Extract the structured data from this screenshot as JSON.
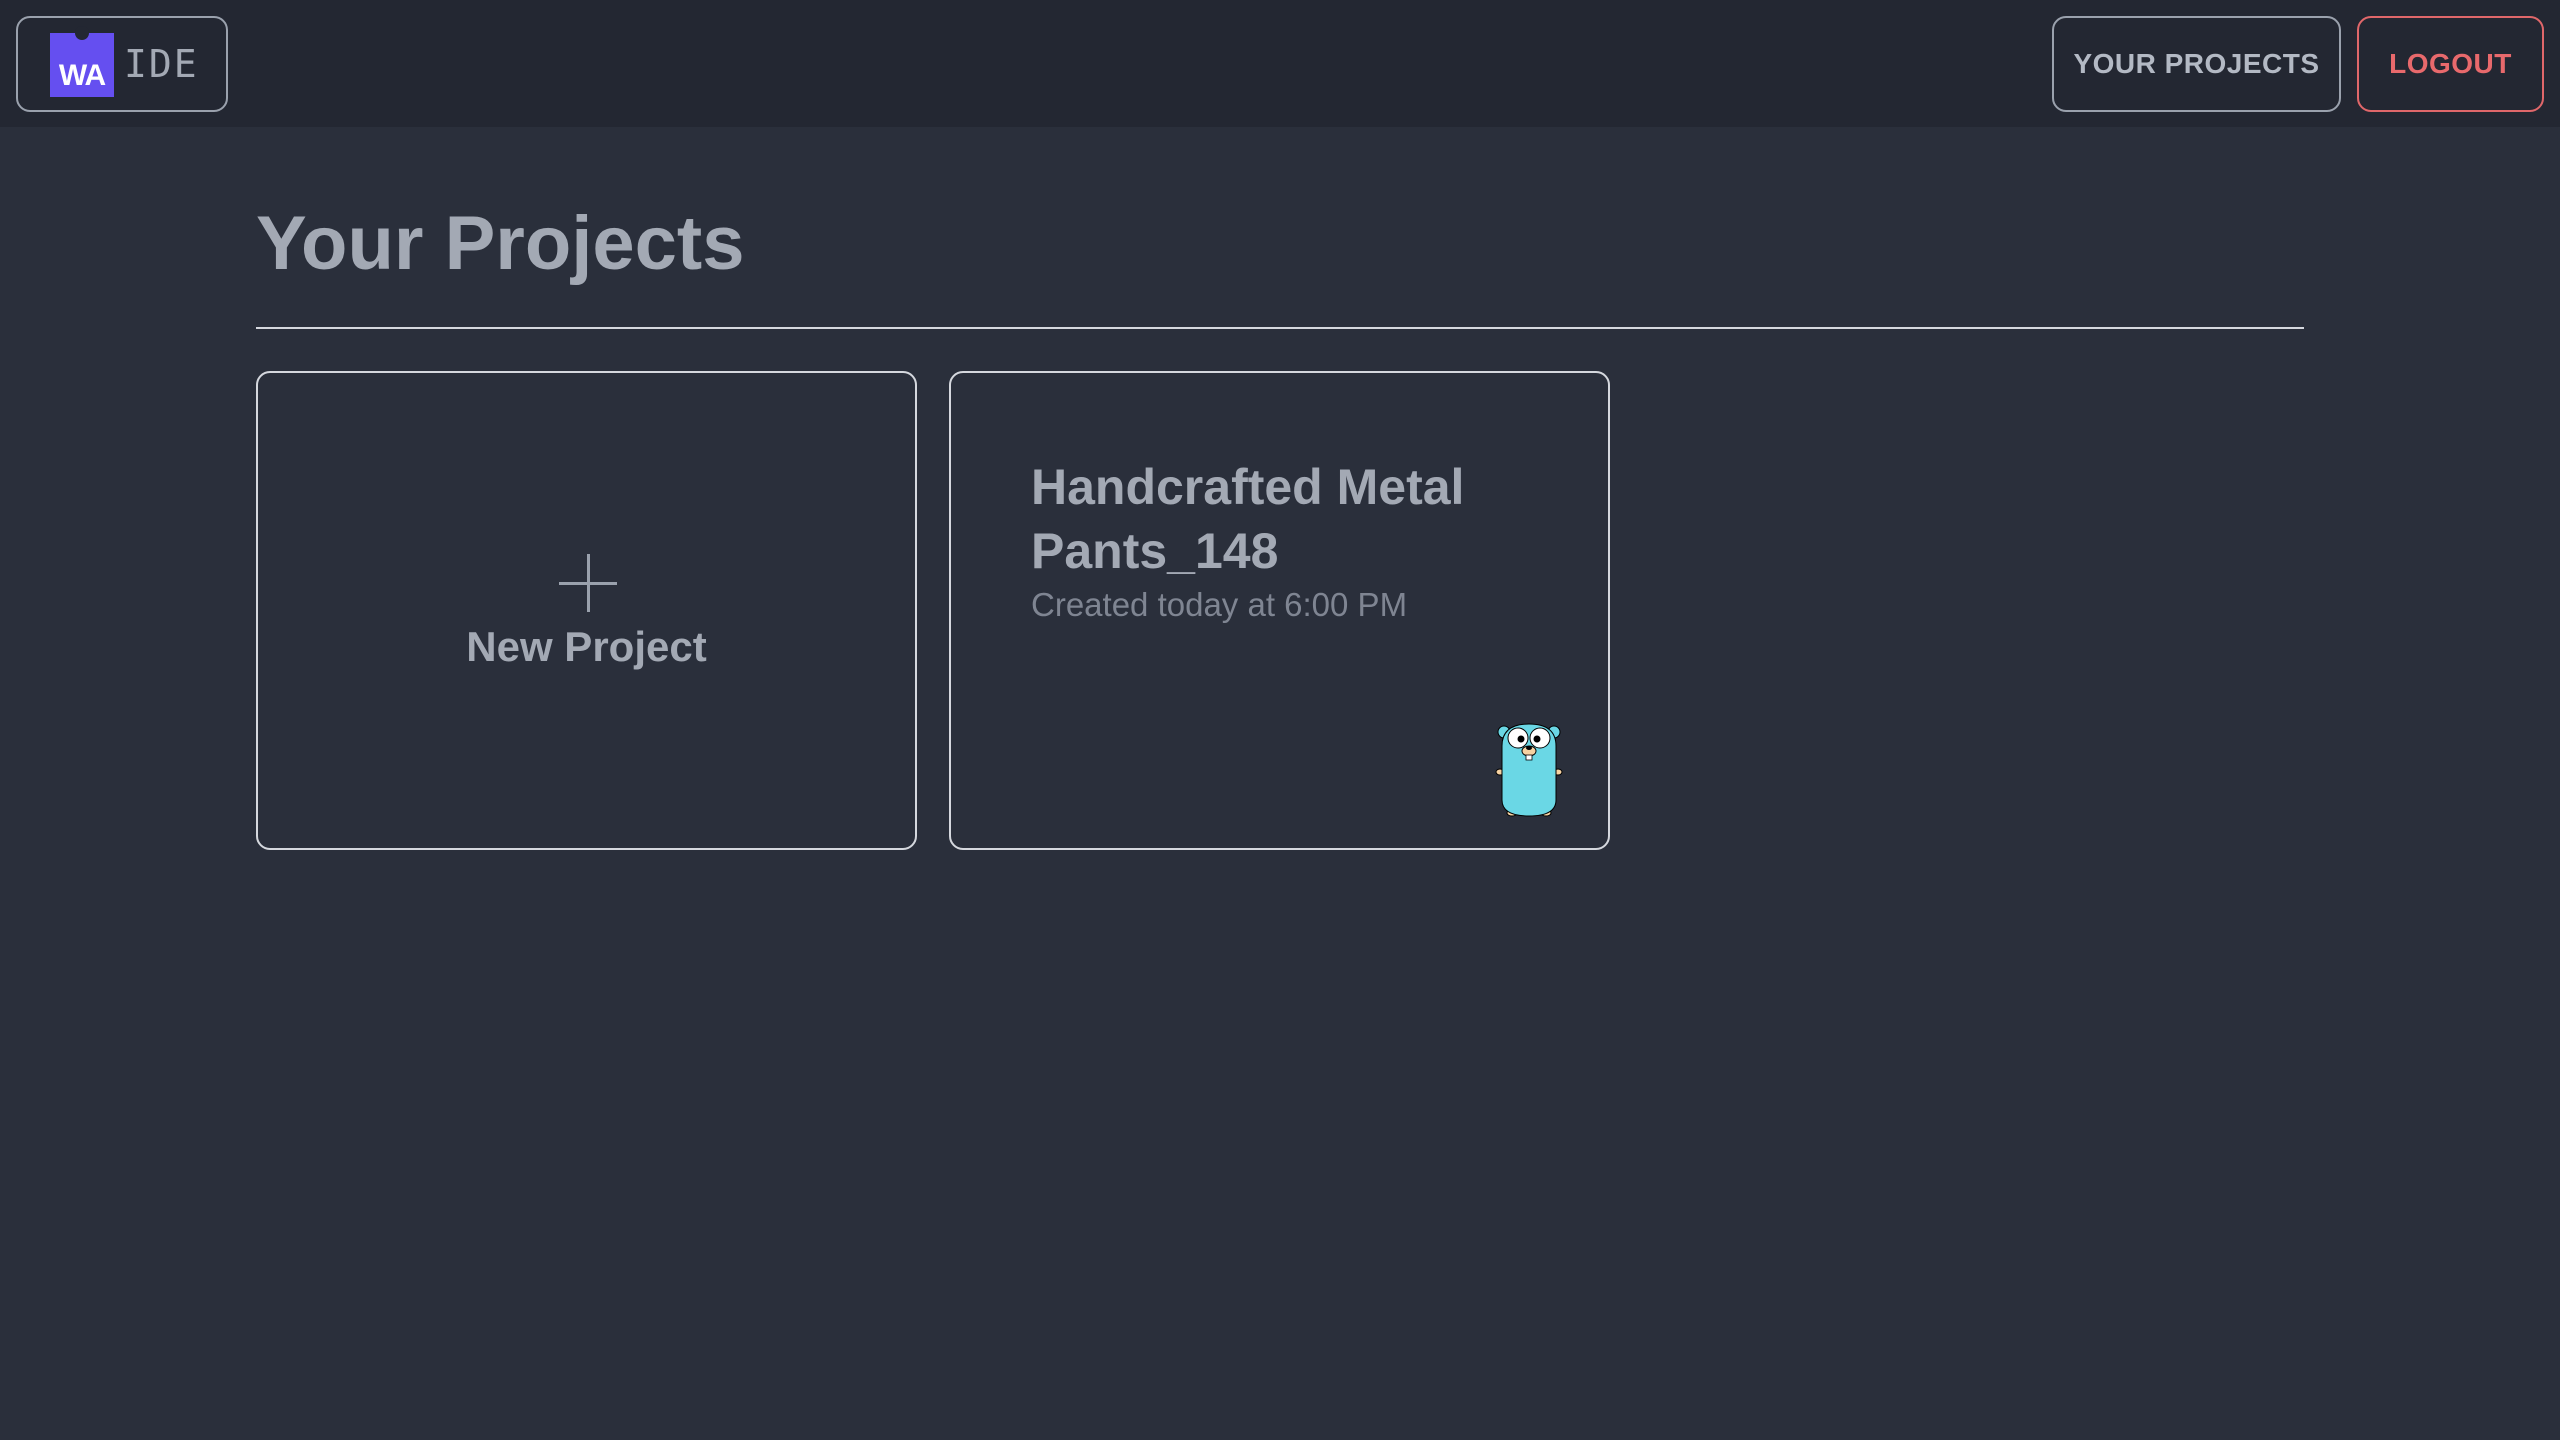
{
  "header": {
    "logo": {
      "mark_text": "WA",
      "app_text": "IDE",
      "mark_color": "#654ff0"
    },
    "nav": {
      "projects_label": "YOUR PROJECTS",
      "logout_label": "LOGOUT",
      "logout_color": "#e8696c"
    }
  },
  "main": {
    "title": "Your Projects",
    "new_project": {
      "icon": "plus-icon",
      "label": "New Project"
    },
    "projects": [
      {
        "name": "Handcrafted Metal Pants_148",
        "created": "Created today at 6:00 PM",
        "language_icon": "go-gopher-icon"
      }
    ]
  },
  "colors": {
    "background": "#2a2f3b",
    "header_background": "#232732",
    "text": "#a3a9b4",
    "border": "#d5d8de"
  }
}
